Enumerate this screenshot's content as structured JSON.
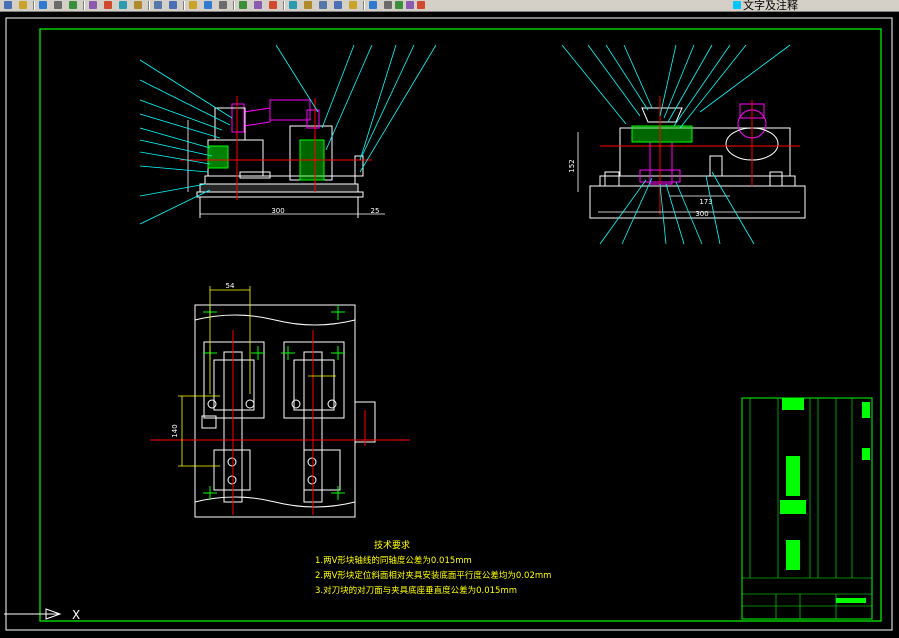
{
  "toolbar": {
    "buttons": [
      "new-icon",
      "open-icon",
      "save-icon",
      "print-icon",
      "preview-icon",
      "plot-icon",
      "cut-icon",
      "copy-icon",
      "paste-icon",
      "match-icon",
      "undo-icon",
      "redo-icon",
      "pan-icon",
      "zoom-realtime-icon",
      "zoom-window-icon",
      "zoom-previous-icon",
      "properties-icon",
      "design-center-icon",
      "tool-palette-icon",
      "sheet-set-icon",
      "markup-icon",
      "calc-icon",
      "help-icon",
      "layer-manager-icon",
      "layer-state-icon",
      "layer-color-icon",
      "layer-lock-icon"
    ],
    "current_layer": "文字及注释",
    "current_layer_color": "#00c8ff"
  },
  "drawing": {
    "dim_front_width": "300",
    "dim_front_right": "25",
    "dim_side_height": "152",
    "dim_side_inner": "173",
    "dim_side_width": "300",
    "dim_plan_width": "54",
    "dim_plan_height": "140",
    "notes_title": "技术要求",
    "notes": [
      "1.两V形块轴线的同轴度公差为0.015mm",
      "2.两V形块定位斜面相对夹具安装底面平行度公差均为0.02mm",
      "3.对刀块的对刀面与夹具底座垂直度公差为0.015mm"
    ]
  },
  "ucs": {
    "x_label": "X"
  },
  "colors": {
    "background": "#000000",
    "frame": "#00ff00",
    "leader": "#00ffff",
    "geometry": "#ffffff",
    "centerline": "#ff0000",
    "dimension": "#ffff00",
    "highlight": "#ff00ff",
    "notes_text": "#ffff00"
  }
}
